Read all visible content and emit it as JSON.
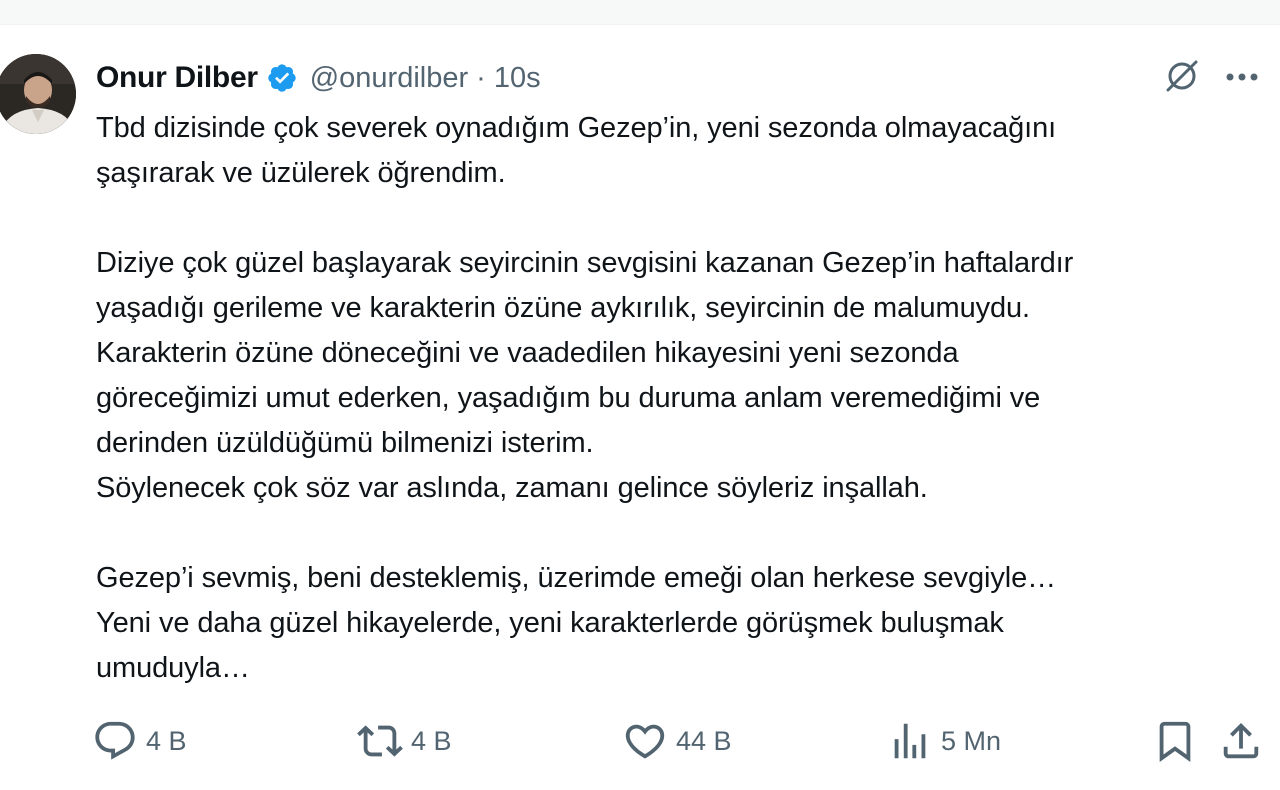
{
  "tweet": {
    "author_name": "Onur Dilber",
    "handle": "@onurdilber",
    "separator": "·",
    "time": "10s",
    "text": "Tbd dizisinde çok severek oynadığım Gezep’in, yeni sezonda olmayacağını\nşaşırarak ve üzülerek öğrendim.\n\nDiziye çok güzel başlayarak seyircinin sevgisini kazanan Gezep’in haftalardır\nyaşadığı gerileme ve karakterin özüne aykırılık, seyircinin de malumuydu.\nKarakterin özüne döneceğini ve vaadedilen hikayesini yeni sezonda\ngöreceğimizi umut ederken, yaşadığım bu duruma anlam veremediğimi ve\nderinden üzüldüğümü bilmenizi isterim.\nSöylenecek çok söz var aslında, zamanı gelince söyleriz inşallah.\n\nGezep’i sevmiş, beni desteklemiş, üzerimde emeği olan herkese sevgiyle…\nYeni ve daha güzel hikayelerde, yeni karakterlerde görüşmek buluşmak\numuduyla…"
  },
  "actions": {
    "replies": "4 B",
    "reposts": "4 B",
    "likes": "44 B",
    "views": "5 Mn"
  },
  "icons": {
    "verified": "verified-badge-icon",
    "grok": "grok-icon",
    "more": "more-icon",
    "reply": "reply-icon",
    "repost": "repost-icon",
    "like": "like-icon",
    "views": "views-icon",
    "bookmark": "bookmark-icon",
    "share": "share-icon"
  },
  "colors": {
    "verified": "#1d9bf0",
    "text": "#0f1419",
    "secondary": "#536471"
  }
}
